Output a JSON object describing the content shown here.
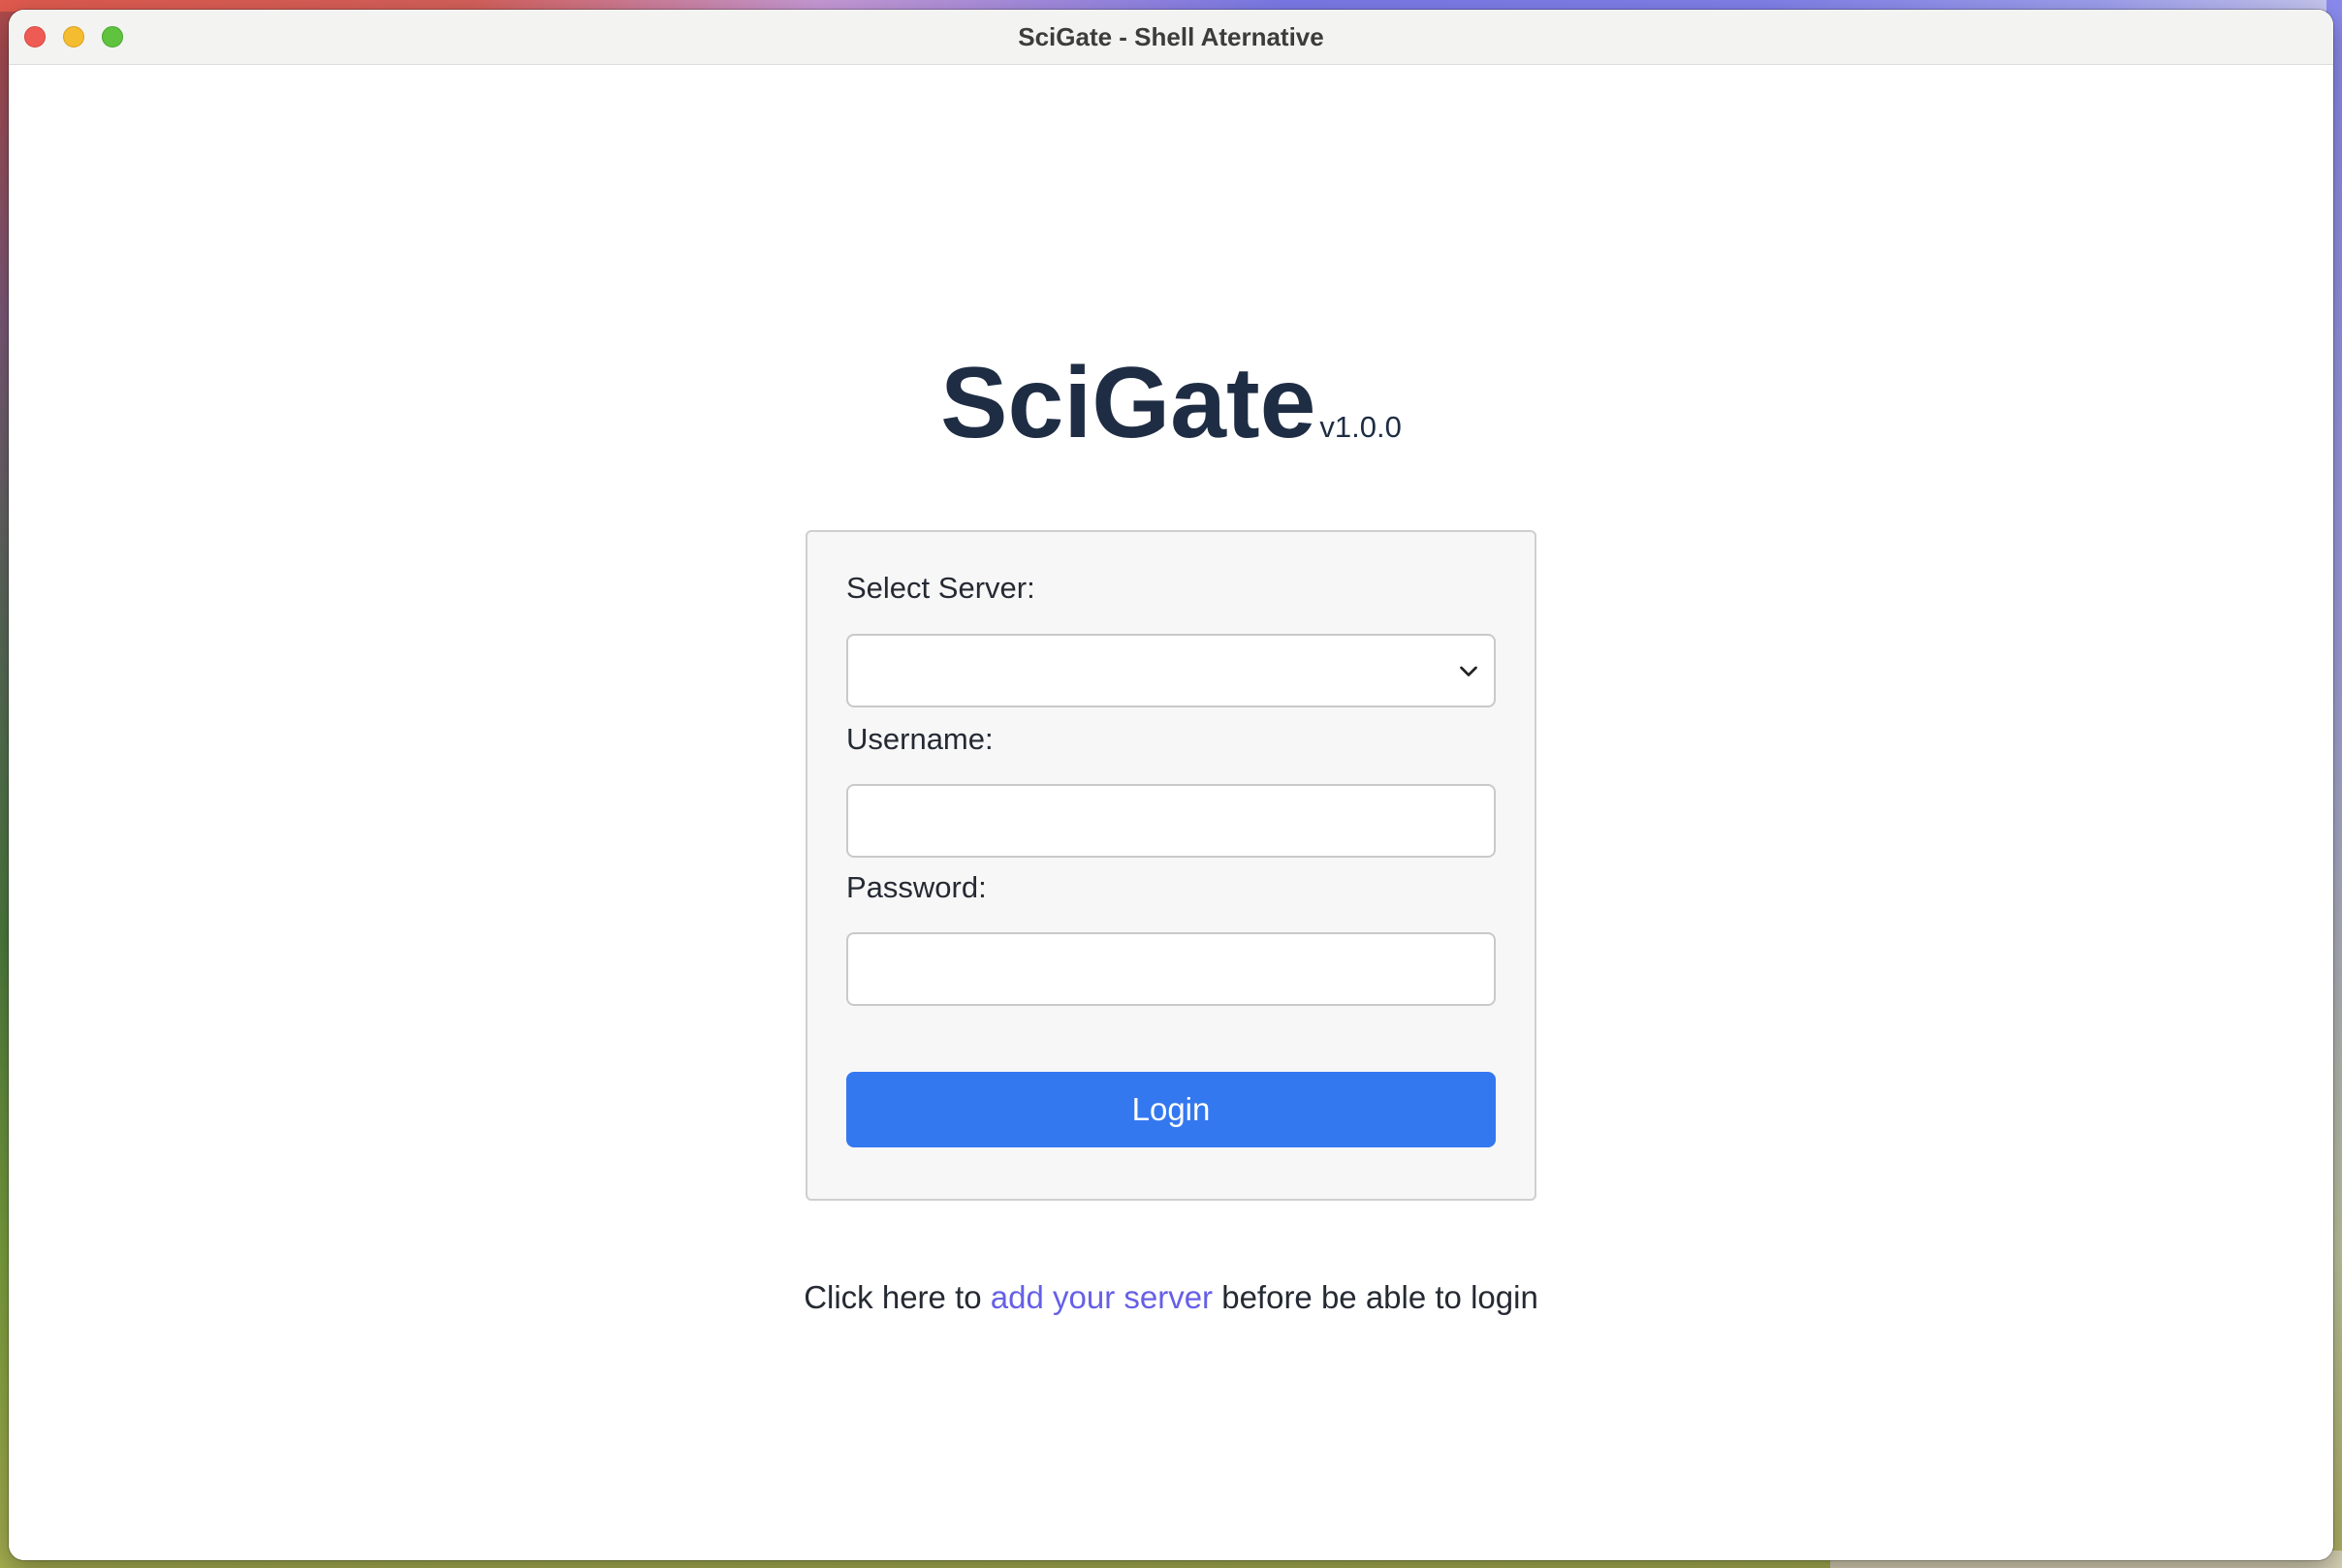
{
  "window": {
    "title": "SciGate - Shell Aternative"
  },
  "brand": {
    "name": "SciGate",
    "version": "v1.0.0"
  },
  "login_form": {
    "server_label": "Select Server:",
    "server_selected": "",
    "username_label": "Username:",
    "username_value": "",
    "password_label": "Password:",
    "password_value": "",
    "login_label": "Login"
  },
  "footer": {
    "prefix": "Click here to",
    "link_text": "add your server",
    "suffix": "before be able to login"
  },
  "colors": {
    "accent": "#3478f0",
    "link": "#6660e6",
    "brand_text": "#1f2d44"
  },
  "icons": {
    "select_chevron": "chevron-down-icon"
  }
}
